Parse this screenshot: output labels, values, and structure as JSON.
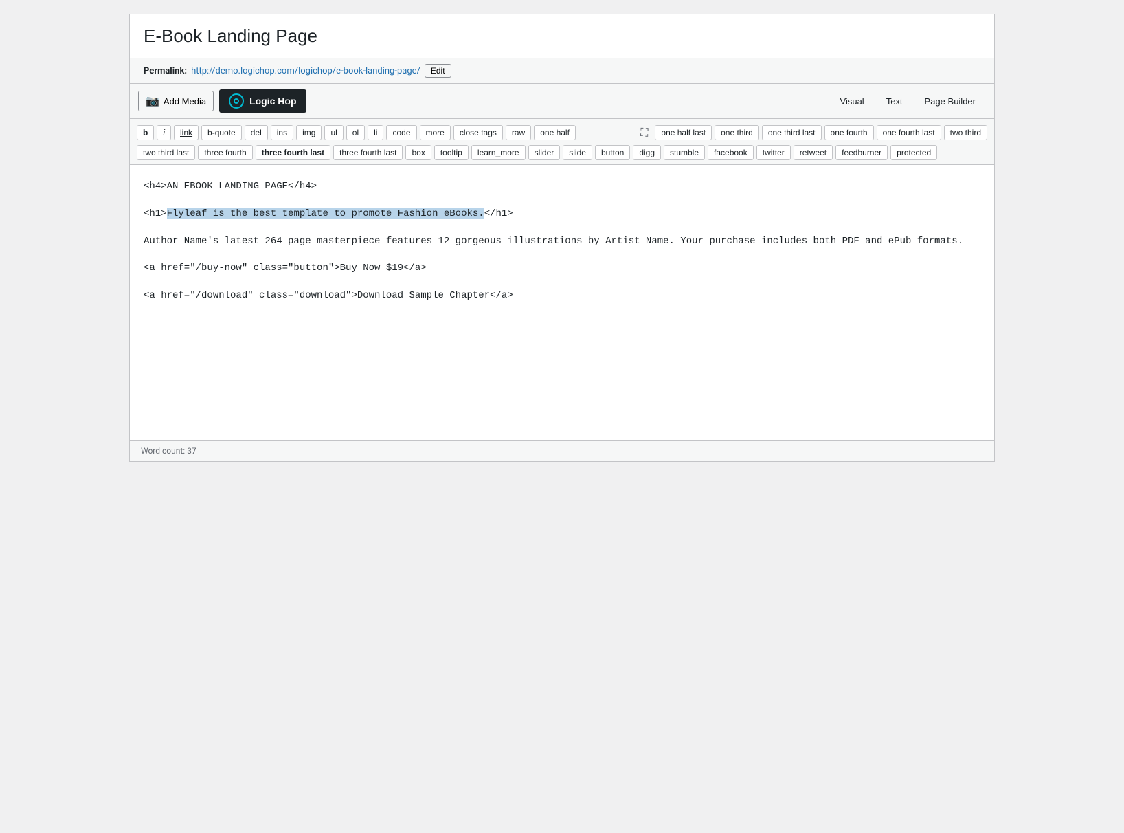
{
  "page": {
    "title": "E-Book Landing Page",
    "permalink_label": "Permalink:",
    "permalink_url": "http://demo.logichop.com/logichop/e-book-landing-page/",
    "permalink_url_text": "http://demo.logichop.com/logichop/e-book-landing-page/",
    "edit_btn": "Edit"
  },
  "toolbar": {
    "add_media_label": "Add Media",
    "logic_hop_label": "Logic Hop",
    "view_visual": "Visual",
    "view_text": "Text",
    "view_page_builder": "Page Builder"
  },
  "formatting": {
    "buttons": [
      {
        "id": "b",
        "label": "b",
        "style": "bold"
      },
      {
        "id": "i",
        "label": "i",
        "style": "italic"
      },
      {
        "id": "link",
        "label": "link",
        "style": "underline"
      },
      {
        "id": "b-quote",
        "label": "b-quote",
        "style": "normal"
      },
      {
        "id": "del",
        "label": "del",
        "style": "strikethrough"
      },
      {
        "id": "ins",
        "label": "ins",
        "style": "normal"
      },
      {
        "id": "img",
        "label": "img",
        "style": "normal"
      },
      {
        "id": "ul",
        "label": "ul",
        "style": "normal"
      },
      {
        "id": "ol",
        "label": "ol",
        "style": "normal"
      },
      {
        "id": "li",
        "label": "li",
        "style": "normal"
      },
      {
        "id": "code",
        "label": "code",
        "style": "normal"
      },
      {
        "id": "more",
        "label": "more",
        "style": "normal"
      },
      {
        "id": "close-tags",
        "label": "close tags",
        "style": "normal"
      },
      {
        "id": "raw",
        "label": "raw",
        "style": "normal"
      },
      {
        "id": "one-half",
        "label": "one half",
        "style": "normal"
      },
      {
        "id": "one-half-last",
        "label": "one half last",
        "style": "normal"
      },
      {
        "id": "one-third",
        "label": "one third",
        "style": "normal"
      },
      {
        "id": "one-third-last",
        "label": "one third last",
        "style": "normal"
      },
      {
        "id": "one-fourth",
        "label": "one fourth",
        "style": "normal"
      },
      {
        "id": "one-fourth-last",
        "label": "one fourth last",
        "style": "normal"
      },
      {
        "id": "two-third",
        "label": "two third",
        "style": "normal"
      },
      {
        "id": "two-third-last",
        "label": "two third last",
        "style": "normal"
      },
      {
        "id": "three-fourth",
        "label": "three fourth",
        "style": "normal"
      },
      {
        "id": "three-fourth-last",
        "label": "three fourth last",
        "style": "bold"
      },
      {
        "id": "three-fourth-last-2",
        "label": "three fourth last",
        "style": "normal"
      },
      {
        "id": "box",
        "label": "box",
        "style": "normal"
      },
      {
        "id": "tooltip",
        "label": "tooltip",
        "style": "normal"
      },
      {
        "id": "learn_more",
        "label": "learn_more",
        "style": "normal"
      },
      {
        "id": "slider",
        "label": "slider",
        "style": "normal"
      },
      {
        "id": "slide",
        "label": "slide",
        "style": "normal"
      },
      {
        "id": "button",
        "label": "button",
        "style": "normal"
      },
      {
        "id": "digg",
        "label": "digg",
        "style": "normal"
      },
      {
        "id": "stumble",
        "label": "stumble",
        "style": "normal"
      },
      {
        "id": "facebook",
        "label": "facebook",
        "style": "normal"
      },
      {
        "id": "twitter",
        "label": "twitter",
        "style": "normal"
      },
      {
        "id": "retweet",
        "label": "retweet",
        "style": "normal"
      },
      {
        "id": "feedburner",
        "label": "feedburner",
        "style": "normal"
      },
      {
        "id": "protected",
        "label": "protected",
        "style": "normal"
      }
    ]
  },
  "content": {
    "line1": "<h4>AN EBOOK LANDING PAGE</h4>",
    "line2_before": "<h1>",
    "line2_highlight": "Flyleaf is the best template to promote Fashion eBooks.",
    "line2_after": "</h1>",
    "line3": "Author Name's latest 264 page masterpiece features 12 gorgeous illustrations by Artist Name. Your purchase includes both PDF and ePub formats.",
    "line4": "<a href=\"/buy-now\"  class=\"button\">Buy Now $19</a>",
    "line5": "<a href=\"/download\" class=\"download\">Download Sample Chapter</a>"
  },
  "footer": {
    "word_count_label": "Word count:",
    "word_count": "37"
  }
}
